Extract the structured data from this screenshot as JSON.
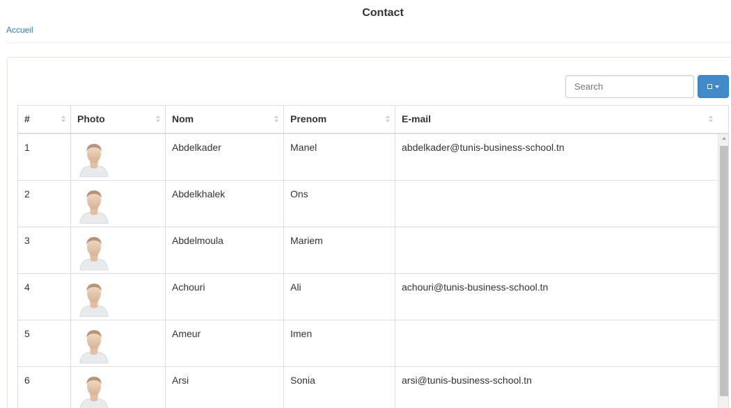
{
  "page": {
    "title": "Contact",
    "breadcrumb": "Accueil"
  },
  "toolbar": {
    "search_placeholder": "Search"
  },
  "table": {
    "columns": [
      "#",
      "Photo",
      "Nom",
      "Prenom",
      "E-mail"
    ],
    "rows": [
      {
        "num": "1",
        "nom": "Abdelkader",
        "prenom": "Manel",
        "email": "abdelkader@tunis-business-school.tn"
      },
      {
        "num": "2",
        "nom": "Abdelkhalek",
        "prenom": "Ons",
        "email": ""
      },
      {
        "num": "3",
        "nom": "Abdelmoula",
        "prenom": "Mariem",
        "email": ""
      },
      {
        "num": "4",
        "nom": "Achouri",
        "prenom": "Ali",
        "email": "achouri@tunis-business-school.tn"
      },
      {
        "num": "5",
        "nom": "Ameur",
        "prenom": "Imen",
        "email": ""
      },
      {
        "num": "6",
        "nom": "Arsi",
        "prenom": "Sonia",
        "email": "arsi@tunis-business-school.tn"
      }
    ]
  },
  "icons": {
    "photo": "user-avatar-icon",
    "sort": "sort-both-icon",
    "columns": "columns-toggle-icon"
  },
  "colors": {
    "link": "#337ab7",
    "primary_button": "#428bca",
    "border": "#dddddd"
  }
}
